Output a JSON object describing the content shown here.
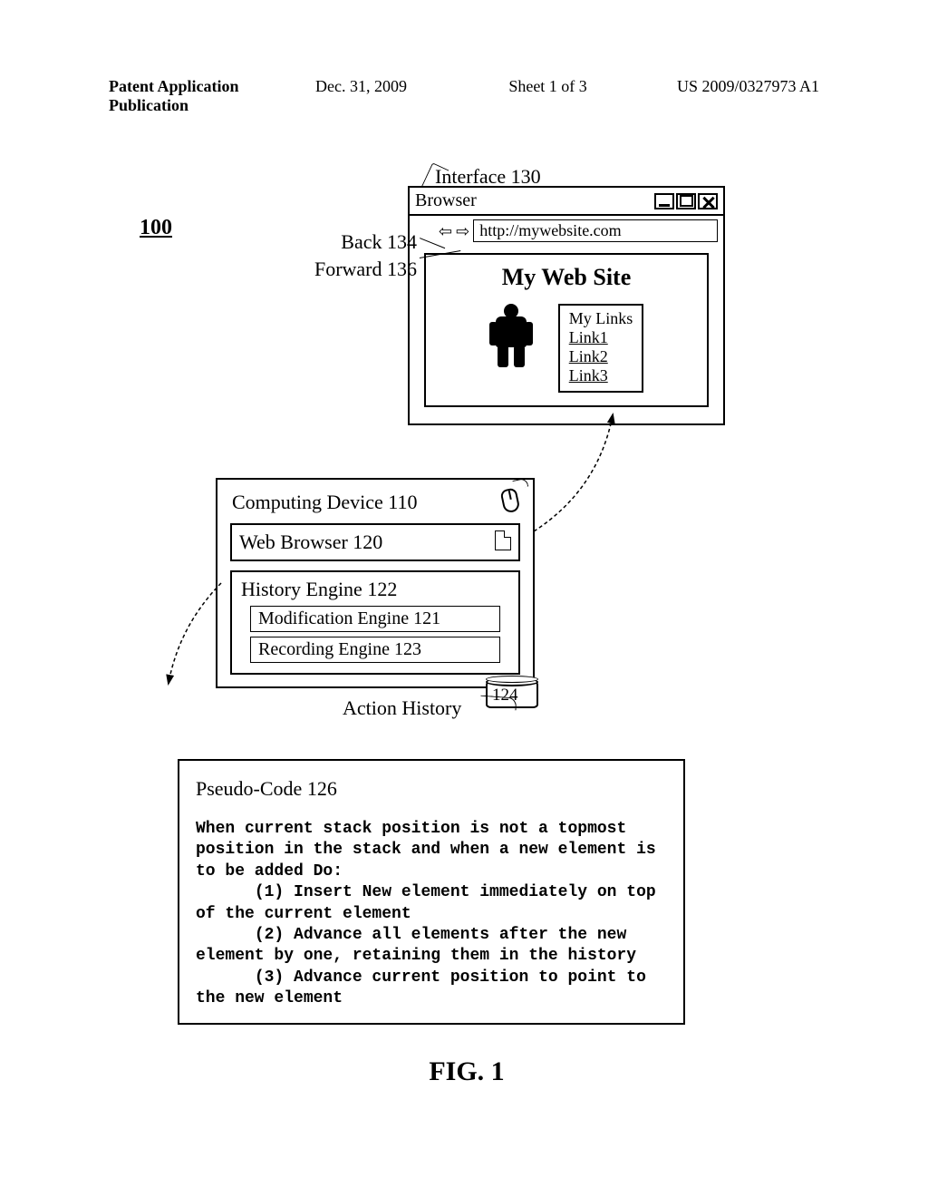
{
  "header": {
    "publication": "Patent Application Publication",
    "date": "Dec. 31, 2009",
    "sheet": "Sheet 1 of 3",
    "docno": "US 2009/0327973 A1"
  },
  "labels": {
    "ref100": "100",
    "interface": "Interface 130",
    "back": "Back 134",
    "forward": "Forward 136",
    "action_history": "Action History",
    "figure": "FIG. 1"
  },
  "browser": {
    "title": "Browser",
    "url": "http://mywebsite.com",
    "page_heading": "My Web Site",
    "links_title": "My Links",
    "links": [
      "Link1",
      "Link2",
      "Link3"
    ]
  },
  "device": {
    "title": "Computing Device 110",
    "web_browser": "Web Browser 120",
    "history_engine": "History Engine 122",
    "modification_engine": "Modification Engine 121",
    "recording_engine": "Recording Engine 123",
    "datastore_num": "124"
  },
  "pseudo": {
    "title": "Pseudo-Code 126",
    "body": "When current stack position is not a topmost position in the stack and when a new element is to be added Do:\n      (1) Insert New element immediately on top of the current element\n      (2) Advance all elements after the new element by one, retaining them in the history\n      (3) Advance current position to point to the new element"
  }
}
